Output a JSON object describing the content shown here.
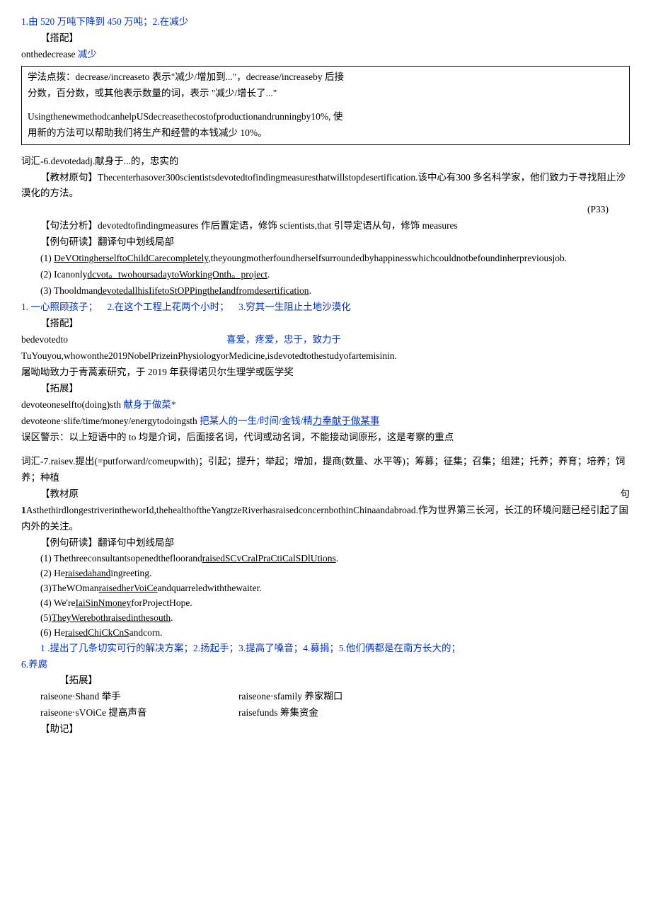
{
  "line1": "1.由 520 万吨下降到 450 万吨；2.在减少",
  "l2": "【搭配】",
  "l3a": "onthedecrease ",
  "l3b": "减少",
  "box": {
    "p1": "学法点拨：decrease/increaseto 表示\"减少/增加到...\"，decrease/increaseby 后接",
    "p2": "分数，百分数，或其他表示数量的词，表示 \"减少/增长了...\"",
    "p3": "UsingthenewmethodcanhelpUSdecreasethecostofproductionandrunningby10%, 使",
    "p4": "用新的方法可以帮助我们将生产和经营的本钱减少 10%。"
  },
  "v6": {
    "title": "词汇-6.devotedadj.献身于...的，忠实的",
    "origPre": "【教材原句】Thecenterhasover300scientistsdevotedtofindingmeasuresthatwillstopdesertification.该中心有300 多名科学家，他们致力于寻找阻止沙漠化的方法。 ",
    "origPage": "(P33)",
    "grammar": "【句法分析】devotedtofindingmeasures 作后置定语，修饰 scientists,that 引导定语从句，修饰 measures",
    "study": "【例句研读】翻译句中划线局部",
    "ex1a": "(1)  ",
    "ex1u": "DeVOtingherselftoChildCarecompletely",
    "ex1b": ",theyoungmotherfoundherselfsurroundedbyhappinesswhichcouldnotbefoundinherpreviousjob.",
    "ex2a": "(2)   Icanonly",
    "ex2u": "dcvot。twohoursadaytoWorkingOnth。project",
    "ex2b": ".",
    "ex3a": "(3)   Thooldman",
    "ex3u": "devotedallhisIifetoStOPPingtheIandfromdesertification",
    "ex3b": ".",
    "ans1": "1. 一心照顾孩子；",
    "ans2": "2.在这个工程上花两个小时；",
    "ans3": "3.穷其一生阻止土地沙漠化",
    "match": "【搭配】",
    "m1": "bedevotedto",
    "m1b": "喜爱，疼爱，忠于，致力于",
    "m2": "  TuYouyou,whowonthe2019NobelPrizeinPhysiologyorMedicine,isdevotedtothestudyofartemisinin.",
    "m3": "屠呦呦致力于青蒿素研究，于 2019 年获得诺贝尔生理学或医学奖",
    "ext": "【拓展】",
    "ext1a": "devoteoneselfto(doing)sth ",
    "ext1b": "献身于做菜*",
    "ext2a": "  devoteone·slife/time/money/energytodoingsth ",
    "ext2b": "把某人的一生/时间/金钱/精",
    "ext2c": "力奉献于做某事",
    "note": "误区警示：以上短语中的 to 均是介词，后面接名词，代词或动名词，不能接动词原形，这是考察的重点"
  },
  "v7": {
    "title": "  词汇-7.raisev.提出(=putforward/comeupwith)；引起；提升；举起；增加，提商(数量、水平等)；筹募；征集；召集；组建；托养；养育；培养；饲养；种植",
    "origRowL": "【",
    "origRowM1": "教",
    "origRowM2": "材",
    "origRowM3": "原",
    "origRowR": "句",
    "origRowNum": "1",
    "orig": "AsthethirdlongestriverintheworId,thehealthoftheYangtzeRiverhasraisedconcernbothinChinaandabroad.作为世界第三长河，长江的环境问题已经引起了国内外的关注。",
    "study": "【例句研读】翻译句中划线局部",
    "e1a": "(1)  Thethreeconsultantsopenedthefloorand",
    "e1u": "raisedSCvCralPraCtiCalSDlUtions",
    "e1b": ".",
    "e2a": "(2)  He",
    "e2u": "raisedahand",
    "e2b": "ingreeting.",
    "e3a": "(3)TheWOman",
    "e3u": "raisedherVoiCe",
    "e3b": "andquarreledwiththewaiter.",
    "e4a": "(4)     We're",
    "e4u": "IaiSinNmoney",
    "e4b": "forProjectHope.",
    "e5a": "(5)",
    "e5u": "TheyWerebothraisedinthesouth",
    "e5b": ".",
    "e6a": "(6)  He",
    "e6u": "raisedChiCkCnS",
    "e6b": "andcorn.",
    "ansRow1": "1 .提出了几条切实可行的解决方案；2.扬起手；3.提高了嗓音；4.募捐；5.他们俩都是在南方长大的；",
    "ansRow2": "6.养腐",
    "ext": "【拓展】",
    "c1l": "raiseone·Shand 举手",
    "c1r": "raiseone·sfamily 养家糊口",
    "c2l": "raiseone·sVOiCe 提高声音",
    "c2r": "raisefunds 筹集资金",
    "help": "【助记】"
  }
}
